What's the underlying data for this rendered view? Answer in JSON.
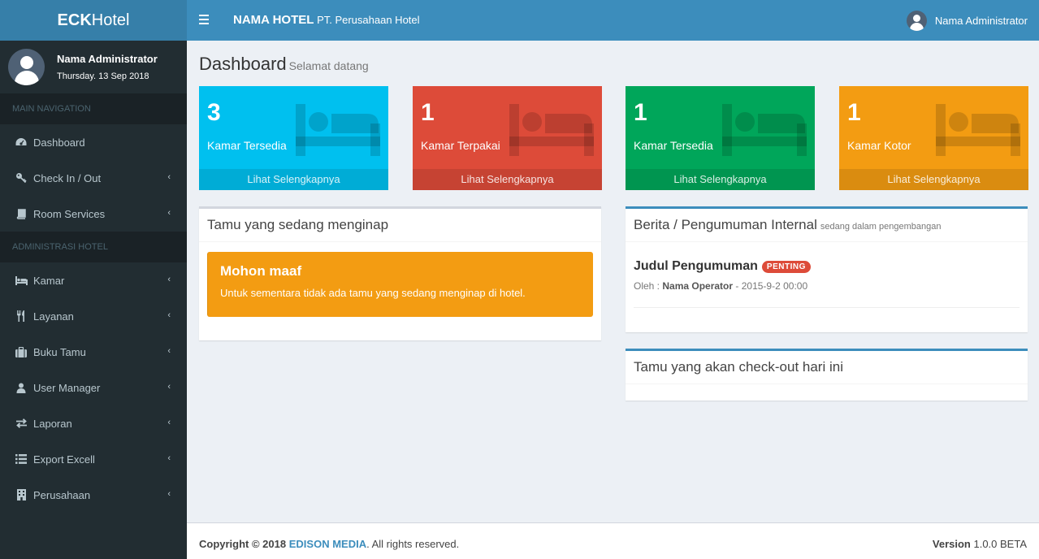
{
  "app": {
    "logo_bold": "ECK",
    "logo_rest": "Hotel"
  },
  "user": {
    "name": "Nama Administrator",
    "date": "Thursday. 13 Sep 2018"
  },
  "sidebar": {
    "header_main": "MAIN NAVIGATION",
    "header_admin": "ADMINISTRASI HOTEL",
    "items": [
      {
        "label": "Dashboard",
        "icon": "dashboard-icon"
      },
      {
        "label": "Check In / Out",
        "icon": "key-icon"
      },
      {
        "label": "Room Services",
        "icon": "book-icon"
      },
      {
        "label": "Kamar",
        "icon": "bed-icon"
      },
      {
        "label": "Layanan",
        "icon": "cutlery-icon"
      },
      {
        "label": "Buku Tamu",
        "icon": "suitcase-icon"
      },
      {
        "label": "User Manager",
        "icon": "user-icon"
      },
      {
        "label": "Laporan",
        "icon": "exchange-icon"
      },
      {
        "label": "Export Excell",
        "icon": "list-icon"
      },
      {
        "label": "Perusahaan",
        "icon": "building-icon"
      }
    ]
  },
  "header": {
    "brand_bold": "NAMA HOTEL",
    "brand_rest": "PT. Perusahaan Hotel",
    "user_name": "Nama Administrator"
  },
  "page": {
    "title": "Dashboard",
    "subtitle": "Selamat datang"
  },
  "stats": [
    {
      "value": "3",
      "label": "Kamar Tersedia",
      "link": "Lihat Selengkapnya",
      "color": "#00c0ef"
    },
    {
      "value": "1",
      "label": "Kamar Terpakai",
      "link": "Lihat Selengkapnya",
      "color": "#dd4b39"
    },
    {
      "value": "1",
      "label": "Kamar Tersedia",
      "link": "Lihat Selengkapnya",
      "color": "#00a65a"
    },
    {
      "value": "1",
      "label": "Kamar Kotor",
      "link": "Lihat Selengkapnya",
      "color": "#f39c12"
    }
  ],
  "guests_box": {
    "title": "Tamu yang sedang menginap",
    "alert_title": "Mohon maaf",
    "alert_body": "Untuk sementara tidak ada tamu yang sedang menginap di hotel."
  },
  "news_box": {
    "title": "Berita / Pengumuman Internal",
    "subtitle": "sedang dalam pengembangan",
    "item_title": "Judul Pengumuman",
    "item_badge": "PENTING",
    "item_by": "Oleh :",
    "item_author": "Nama Operator",
    "item_date": "- 2015-9-2 00:00"
  },
  "checkout_box": {
    "title": "Tamu yang akan check-out hari ini"
  },
  "footer": {
    "copyright": "Copyright © 2018",
    "company": "EDISON MEDIA",
    "rights": ". All rights reserved.",
    "version_label": "Version",
    "version_value": "1.0.0 BETA"
  }
}
